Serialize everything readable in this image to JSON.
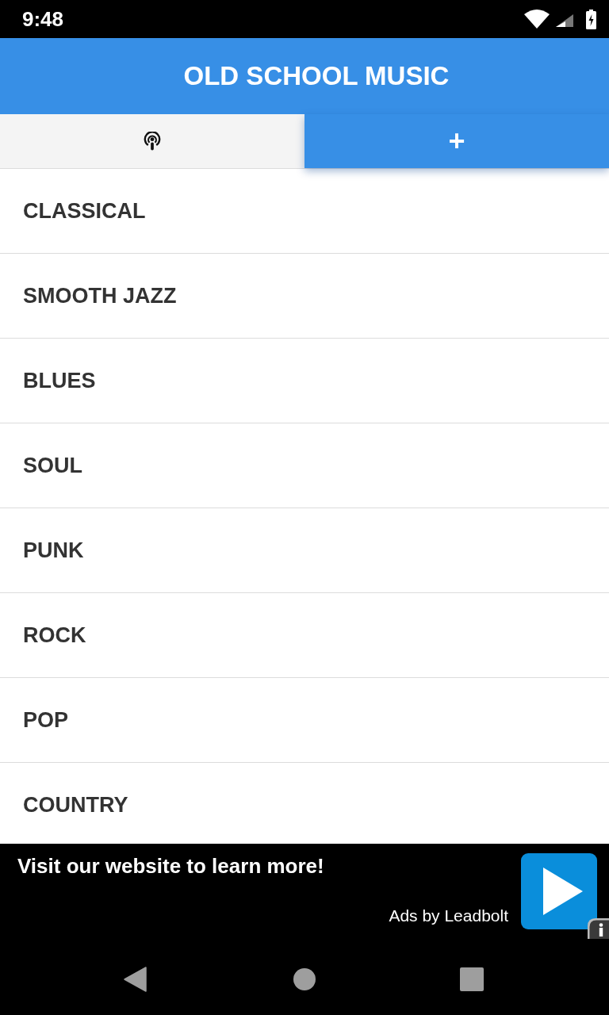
{
  "status_bar": {
    "time": "9:48"
  },
  "app_bar": {
    "title": "OLD SCHOOL MUSIC"
  },
  "tabs": [
    {
      "kind": "icon",
      "selected": false
    },
    {
      "kind": "label",
      "label": "+",
      "selected": true
    }
  ],
  "genres": [
    "CLASSICAL",
    "SMOOTH JAZZ",
    "BLUES",
    "SOUL",
    "PUNK",
    "ROCK",
    "POP",
    "COUNTRY"
  ],
  "ad_banner": {
    "headline": "Visit our website to learn more!",
    "attribution": "Ads by Leadbolt"
  }
}
